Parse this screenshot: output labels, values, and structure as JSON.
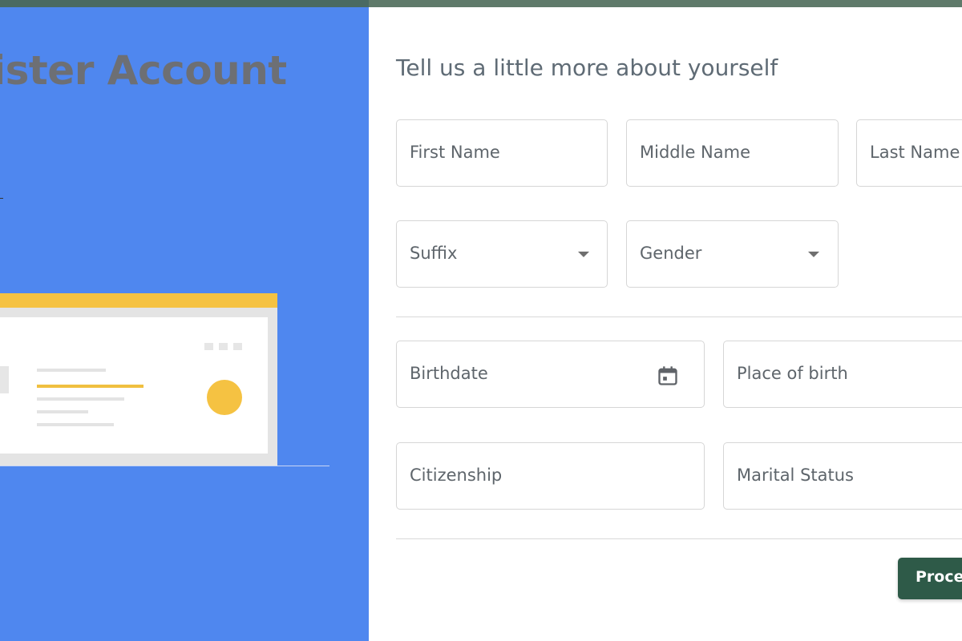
{
  "left": {
    "title": "ister Account"
  },
  "form": {
    "heading": "Tell us a little more about yourself",
    "fields": {
      "first_name": "First Name",
      "middle_name": "Middle Name",
      "last_name": "Last Name",
      "suffix": "Suffix",
      "gender": "Gender",
      "birthdate": "Birthdate",
      "place_of_birth": "Place of birth",
      "citizenship": "Citizenship",
      "marital_status": "Marital Status"
    },
    "proceed_label": "Proceed"
  },
  "icons": {
    "suffix_dropdown": "chevron-down-icon",
    "gender_dropdown": "chevron-down-icon",
    "birthdate_picker": "calendar-icon"
  },
  "colors": {
    "left_panel": "#4f87ef",
    "title_text": "#6d6f74",
    "accent_yellow": "#f5c242",
    "button": "#2e5a48",
    "top_bar": "#5f7a6a"
  }
}
